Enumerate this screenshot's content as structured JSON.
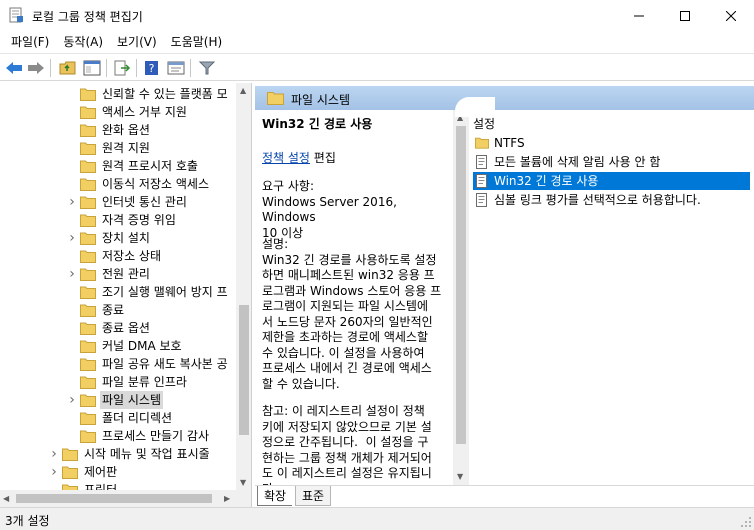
{
  "window": {
    "title": "로컬 그룹 정책 편집기"
  },
  "menu": [
    "파일(F)",
    "동작(A)",
    "보기(V)",
    "도움말(H)"
  ],
  "tree": {
    "items": [
      {
        "label": "신뢰할 수 있는 플랫폼 모",
        "expandable": false,
        "level": 2
      },
      {
        "label": "액세스 거부 지원",
        "expandable": false,
        "level": 2
      },
      {
        "label": "완화 옵션",
        "expandable": false,
        "level": 2
      },
      {
        "label": "원격 지원",
        "expandable": false,
        "level": 2
      },
      {
        "label": "원격 프로시저 호출",
        "expandable": false,
        "level": 2
      },
      {
        "label": "이동식 저장소 액세스",
        "expandable": false,
        "level": 2
      },
      {
        "label": "인터넷 통신 관리",
        "expandable": true,
        "level": 2
      },
      {
        "label": "자격 증명 위임",
        "expandable": false,
        "level": 2
      },
      {
        "label": "장치 설치",
        "expandable": true,
        "level": 2
      },
      {
        "label": "저장소 상태",
        "expandable": false,
        "level": 2
      },
      {
        "label": "전원 관리",
        "expandable": true,
        "level": 2
      },
      {
        "label": "조기 실행 맬웨어 방지 프",
        "expandable": false,
        "level": 2
      },
      {
        "label": "종료",
        "expandable": false,
        "level": 2
      },
      {
        "label": "종료 옵션",
        "expandable": false,
        "level": 2
      },
      {
        "label": "커널 DMA 보호",
        "expandable": false,
        "level": 2
      },
      {
        "label": "파일 공유 새도 복사본 공",
        "expandable": false,
        "level": 2
      },
      {
        "label": "파일 분류 인프라",
        "expandable": false,
        "level": 2
      },
      {
        "label": "파일 시스템",
        "expandable": true,
        "level": 2,
        "selected": true
      },
      {
        "label": "폴더 리디렉션",
        "expandable": false,
        "level": 2
      },
      {
        "label": "프로세스 만들기 감사",
        "expandable": false,
        "level": 2
      },
      {
        "label": "시작 메뉴 및 작업 표시줄",
        "expandable": true,
        "level": 1
      },
      {
        "label": "제어판",
        "expandable": true,
        "level": 1
      },
      {
        "label": "프린터",
        "expandable": false,
        "level": 1
      }
    ]
  },
  "right": {
    "folder_title": "파일 시스템",
    "description": {
      "title": "Win32 긴 경로 사용",
      "link_text": "정책 설정",
      "link_suffix": " 편집",
      "requirements": "요구 사항:\nWindows Server 2016, Windows\n10 이상",
      "explanation": "설명:\nWin32 긴 경로를 사용하도록 설정\n하면 매니페스트된 win32 응용 프\n로그램과 Windows 스토어 응용 프\n로그램이 지원되는 파일 시스템에\n서 노드당 문자 260자의 일반적인\n제한을 초과하는 경로에 액세스할\n수 있습니다. 이 설정을 사용하여\n프로세스 내에서 긴 경로에 액세스\n할 수 있습니다.",
      "note": "참고: 이 레지스트리 설정이 정책\n키에 저장되지 않았으므로 기본 설\n정으로 간주됩니다.  이 설정을 구\n현하는 그룹 정책 개체가 제거되어\n도 이 레지스트리 설정은 유지됩니\n다."
    },
    "settings_header": "설정",
    "settings": [
      {
        "label": "NTFS",
        "type": "folder"
      },
      {
        "label": "모든 볼륨에 삭제 알림 사용 안 함",
        "type": "policy"
      },
      {
        "label": "Win32 긴 경로 사용",
        "type": "policy",
        "selected": true
      },
      {
        "label": "심볼 링크 평가를 선택적으로 허용합니다.",
        "type": "policy"
      }
    ],
    "tabs": [
      "확장",
      "표준"
    ]
  },
  "status": {
    "text": "3개 설정"
  },
  "colors": {
    "selection": "#0078d7",
    "header_gradient_top": "#bcd6f1",
    "header_gradient_bottom": "#a4c2e6",
    "link": "#0645ad"
  }
}
